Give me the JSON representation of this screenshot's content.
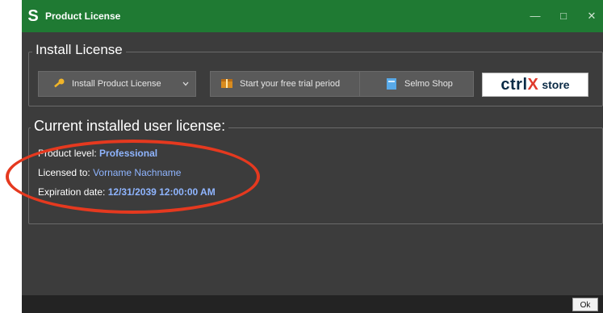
{
  "window": {
    "app_icon_letter": "S",
    "title": "Product License",
    "controls": {
      "minimize": "—",
      "maximize": "□",
      "close": "✕"
    }
  },
  "install_group": {
    "legend": "Install License",
    "buttons": [
      {
        "label": "Install Product License",
        "icon": "key-icon",
        "has_dropdown": true
      },
      {
        "label": "Start your free trial period",
        "icon": "gift-box-icon"
      },
      {
        "label": "Selmo Shop",
        "icon": "shop-icon"
      }
    ],
    "ctrlx_store": {
      "brand_prefix": "ctrl",
      "brand_x": "X",
      "suffix": "store"
    }
  },
  "current_group": {
    "legend": "Current installed user license:",
    "product_level_label": "Product level:",
    "product_level_value": "Professional",
    "licensed_to_label": "Licensed to:",
    "licensed_to_value": "Vorname Nachname",
    "expiration_label": "Expiration date:",
    "expiration_value": "12/31/2039 12:00:00 AM"
  },
  "footer": {
    "ok_label": "Ok"
  },
  "colors": {
    "titlebar": "#1f7a33",
    "window_bg": "#3c3c3c",
    "value_text": "#8fb5ff",
    "highlight_ellipse": "#e5391f"
  }
}
